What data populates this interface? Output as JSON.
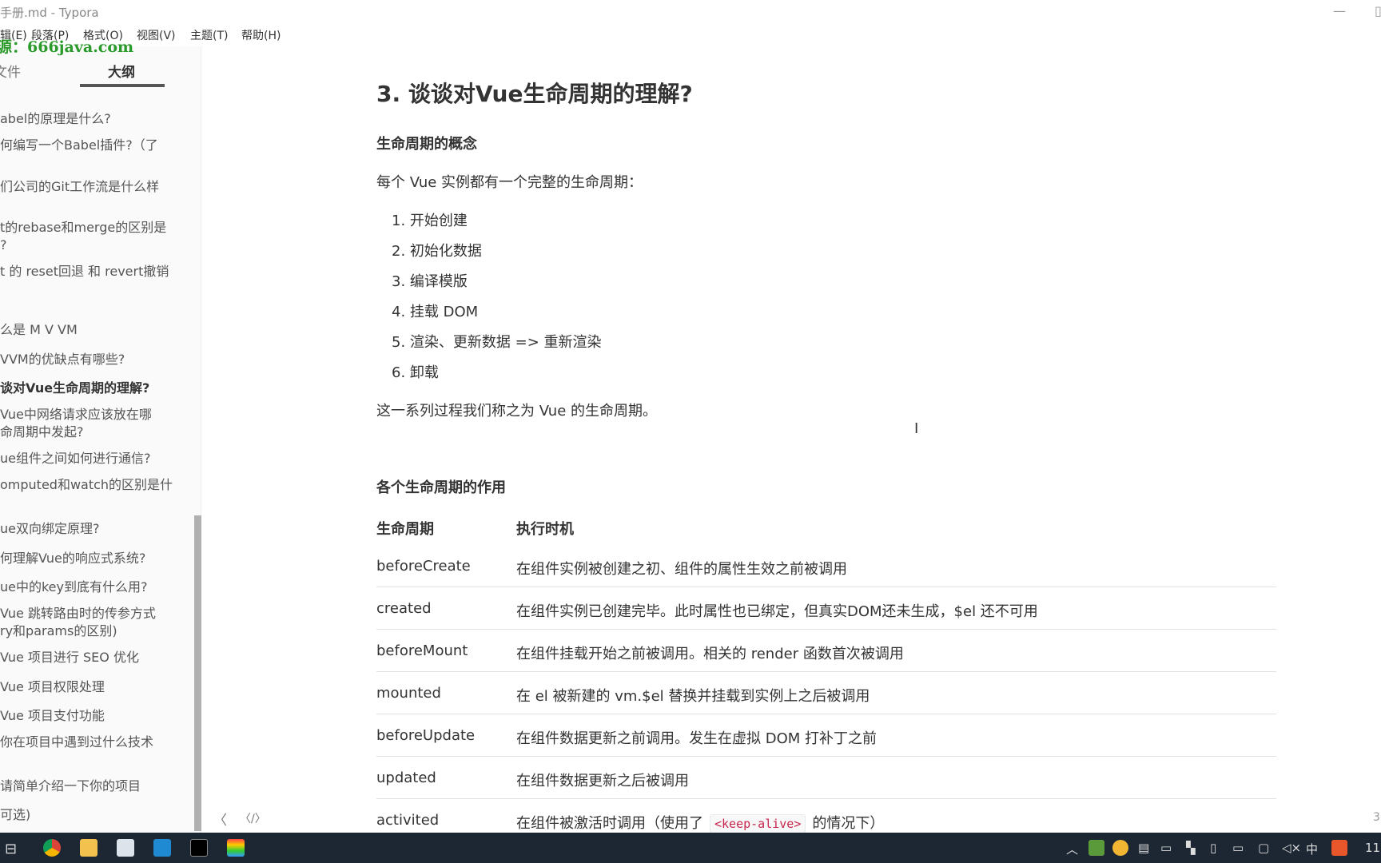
{
  "window": {
    "title": "手册.md - Typora",
    "minimize": "—",
    "maximize": "▯"
  },
  "menu": [
    "编辑(E)",
    "段落(P)",
    "格式(O)",
    "视图(V)",
    "主题(T)",
    "帮助(H)"
  ],
  "watermark": "源：666java.com",
  "sidebar": {
    "tabs": [
      {
        "label": "文件"
      },
      {
        "label": "大纲",
        "active": true
      }
    ],
    "items": [
      {
        "label": "abel的原理是什么?"
      },
      {
        "label": "何编写一个Babel插件?（了"
      },
      {
        "label": "们公司的Git工作流是什么样"
      },
      {
        "label": "t的rebase和merge的区别是",
        "line2": "?"
      },
      {
        "label": "t 的 reset回退 和 revert撤销"
      },
      {
        "label": "么是 M V VM"
      },
      {
        "label": "VVM的优缺点有哪些?"
      },
      {
        "label": "谈对Vue生命周期的理解?",
        "active": true
      },
      {
        "label": "Vue中网络请求应该放在哪",
        "line2": "命周期中发起?"
      },
      {
        "label": "ue组件之间如何进行通信?"
      },
      {
        "label": "omputed和watch的区别是什"
      },
      {
        "label": "ue双向绑定原理?"
      },
      {
        "label": "何理解Vue的响应式系统?"
      },
      {
        "label": "ue中的key到底有什么用?"
      },
      {
        "label": "Vue 跳转路由时的传参方式",
        "line2": "ry和params的区别)"
      },
      {
        "label": "Vue 项目进行 SEO 优化"
      },
      {
        "label": "Vue 项目权限处理"
      },
      {
        "label": "Vue 项目支付功能"
      },
      {
        "label": "你在项目中遇到过什么技术"
      },
      {
        "label": "请简单介绍一下你的项目"
      },
      {
        "label": "可选)"
      }
    ],
    "footer": {
      "back": "〈",
      "source": "〈/〉"
    }
  },
  "content": {
    "heading": "3. 谈谈对Vue生命周期的理解?",
    "sub1": "生命周期的概念",
    "intro": "每个 Vue 实例都有一个完整的生命周期：",
    "list": [
      "1. 开始创建",
      "2. 初始化数据",
      "3. 编译模版",
      "4. 挂载 DOM",
      "5. 渲染、更新数据 => 重新渲染",
      "6. 卸载"
    ],
    "summary": "这一系列过程我们称之为 Vue 的生命周期。",
    "sub2": "各个生命周期的作用",
    "table": {
      "headers": [
        "生命周期",
        "执行时机"
      ],
      "rows": [
        [
          "beforeCreate",
          "在组件实例被创建之初、组件的属性生效之前被调用"
        ],
        [
          "created",
          "在组件实例已创建完毕。此时属性也已绑定，但真实DOM还未生成，$el 还不可用"
        ],
        [
          "beforeMount",
          "在组件挂载开始之前被调用。相关的 render 函数首次被调用"
        ],
        [
          "mounted",
          "在 el 被新建的 vm.$el 替换并挂载到实例上之后被调用"
        ],
        [
          "beforeUpdate",
          "在组件数据更新之前调用。发生在虚拟 DOM 打补丁之前"
        ],
        [
          "updated",
          "在组件数据更新之后被调用"
        ],
        [
          "activited",
          "在组件被激活时调用（使用了",
          "<keep-alive>",
          "的情况下）"
        ]
      ]
    },
    "word_count": "3"
  },
  "taskbar": {
    "ime": "中",
    "clock": "11"
  }
}
